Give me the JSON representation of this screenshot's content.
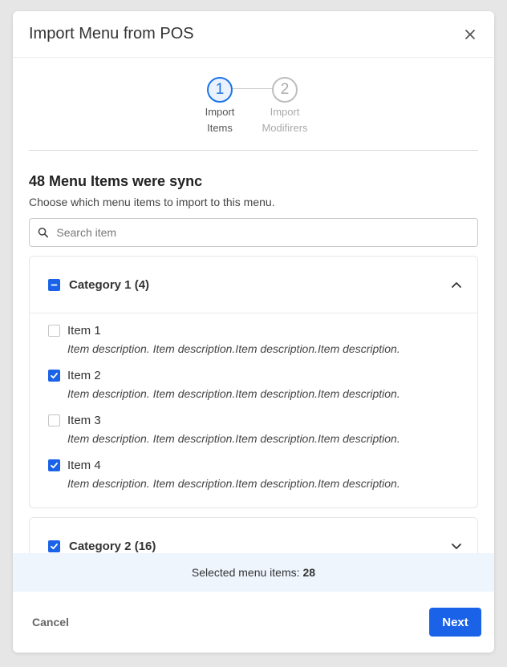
{
  "modal": {
    "title": "Import Menu from POS",
    "close_icon": "close-icon"
  },
  "stepper": {
    "steps": [
      {
        "number": "1",
        "line1": "Import",
        "line2": "Items",
        "state": "active"
      },
      {
        "number": "2",
        "line1": "Import",
        "line2": "Modifirers",
        "state": "inactive"
      }
    ]
  },
  "content": {
    "heading": "48 Menu Items were sync",
    "subheading": "Choose which menu items to import to this menu.",
    "search": {
      "placeholder": "Search item",
      "value": "",
      "icon": "search-icon"
    }
  },
  "categories": [
    {
      "name": "Category 1 (4)",
      "checkbox_state": "indeterminate",
      "expanded": true,
      "items": [
        {
          "name": "Item 1",
          "checked": false,
          "description": "Item description. Item description.Item description.Item description."
        },
        {
          "name": "Item 2",
          "checked": true,
          "description": "Item description. Item description.Item description.Item description."
        },
        {
          "name": "Item 3",
          "checked": false,
          "description": "Item description. Item description.Item description.Item description."
        },
        {
          "name": "Item 4",
          "checked": true,
          "description": "Item description. Item description.Item description.Item description."
        }
      ]
    },
    {
      "name": "Category 2 (16)",
      "checkbox_state": "checked",
      "expanded": false,
      "items": []
    }
  ],
  "selection": {
    "label": "Selected menu items:",
    "count": "28"
  },
  "footer": {
    "cancel_label": "Cancel",
    "next_label": "Next"
  },
  "colors": {
    "primary": "#1a63e8",
    "selected_bar_bg": "#eef5fd"
  }
}
